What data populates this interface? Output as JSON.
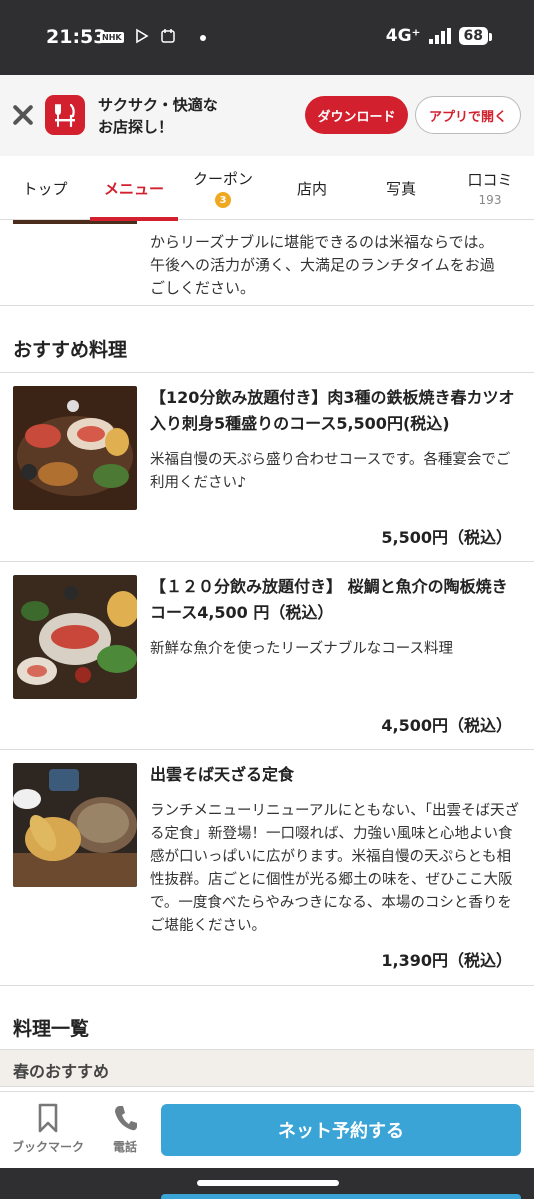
{
  "status_bar": {
    "time": "21:53",
    "icons": [
      "nhk-icon",
      "play-store-icon",
      "calendar-icon"
    ],
    "network": "4G⁺",
    "battery": "68"
  },
  "app_banner": {
    "tagline_1": "サクサク・快適な",
    "tagline_2": "お店探し！",
    "download_label": "ダウンロード",
    "open_app_label": "アプリで開く",
    "brand_color": "#d3202e"
  },
  "tabs": [
    {
      "label": "トップ",
      "active": false
    },
    {
      "label": "メニュー",
      "active": true
    },
    {
      "label": "クーポン",
      "badge": "3",
      "active": false
    },
    {
      "label": "店内",
      "active": false
    },
    {
      "label": "写真",
      "active": false
    },
    {
      "label": "口コミ",
      "count": "193",
      "active": false
    }
  ],
  "intro": {
    "line_1": "からリーズナブルに堪能できるのは米福ならでは。",
    "line_2": "午後への活力が湧く、大満足のランチタイムをお過",
    "line_3": "ごしください。"
  },
  "recommended": {
    "section_title": "おすすめ料理",
    "items": [
      {
        "title": "【120分飲み放題付き】肉3種の鉄板焼き春カツオ入り刺身5種盛りのコース5,500円(税込)",
        "description": "米福自慢の天ぷら盛り合わせコースです。各種宴会でご利用ください♪",
        "price": "5,500円（税込）"
      },
      {
        "title": "【１２０分飲み放題付き】 桜鯛と魚介の陶板焼きコース4,500 円（税込）",
        "description": "新鮮な魚介を使ったリーズナブルなコース料理",
        "price": "4,500円（税込）"
      },
      {
        "title": "出雲そば天ざる定食",
        "description": "ランチメニューリニューアルにともない、「出雲そば天ざる定食」新登場！一口啜れば、力強い風味と心地よい食感が口いっぱいに広がります。米福自慢の天ぷらとも相性抜群。店ごとに個性が光る郷土の味を、ぜひここ大阪で。一度食べたらやみつきになる、本場のコシと香りをご堪能ください。",
        "price": "1,390円（税込）"
      }
    ]
  },
  "menu_list": {
    "section_title": "料理一覧",
    "category": "春のおすすめ"
  },
  "bottom_bar": {
    "bookmark_label": "ブックマーク",
    "phone_label": "電話",
    "reserve_label": "ネット予約する",
    "reserve_color": "#3aa4d6"
  }
}
